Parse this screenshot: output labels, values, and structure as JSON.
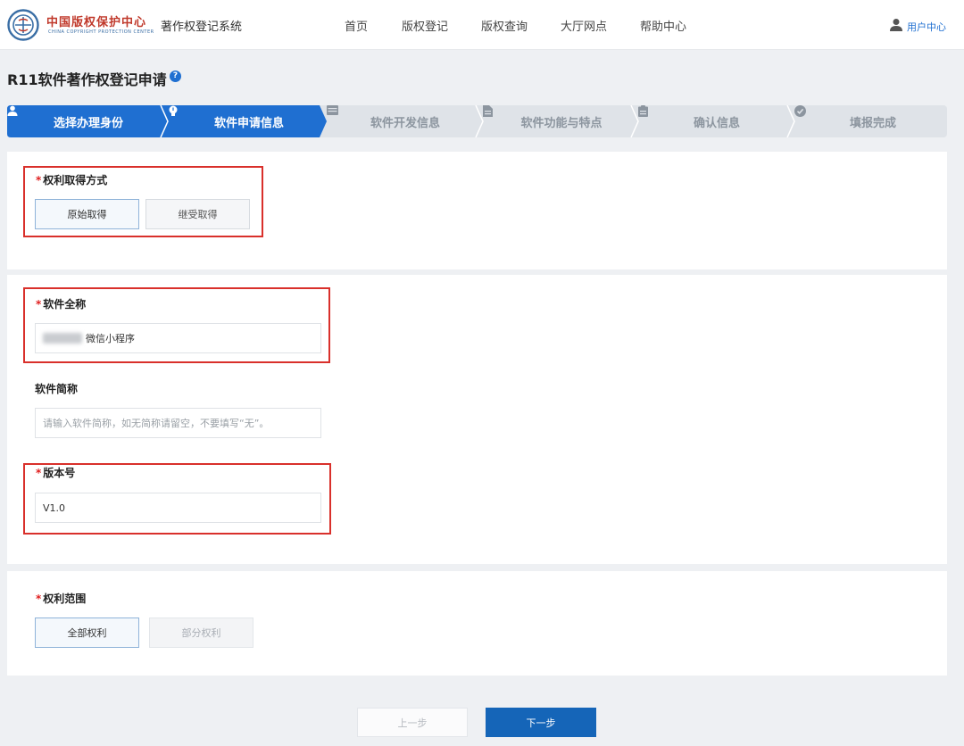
{
  "header": {
    "logo_cn": "中国版权保护中心",
    "logo_en": "CHINA COPYRIGHT PROTECTION CENTER",
    "system_title": "著作权登记系统",
    "nav": [
      "首页",
      "版权登记",
      "版权查询",
      "大厅网点",
      "帮助中心"
    ],
    "user_center": "用户中心"
  },
  "page": {
    "title": "R11软件著作权登记申请",
    "help_icon": "question-circle-icon"
  },
  "steps": [
    {
      "label": "选择办理身份",
      "icon": "user-icon",
      "state": "active"
    },
    {
      "label": "软件申请信息",
      "icon": "lightbulb-icon",
      "state": "active"
    },
    {
      "label": "软件开发信息",
      "icon": "window-icon",
      "state": "inactive"
    },
    {
      "label": "软件功能与特点",
      "icon": "document-icon",
      "state": "inactive"
    },
    {
      "label": "确认信息",
      "icon": "clipboard-icon",
      "state": "inactive"
    },
    {
      "label": "填报完成",
      "icon": "check-circle-icon",
      "state": "inactive"
    }
  ],
  "form": {
    "acquisition": {
      "required_mark": "*",
      "label": "权利取得方式",
      "options": [
        "原始取得",
        "继受取得"
      ],
      "selected": "原始取得"
    },
    "full_name": {
      "required_mark": "*",
      "label": "软件全称",
      "value": "微信小程序"
    },
    "short_name": {
      "label": "软件简称",
      "placeholder": "请输入软件简称，如无简称请留空，不要填写“无”。"
    },
    "version": {
      "required_mark": "*",
      "label": "版本号",
      "value": "V1.0"
    },
    "scope": {
      "required_mark": "*",
      "label": "权利范围",
      "options": [
        "全部权利",
        "部分权利"
      ],
      "selected": "全部权利"
    }
  },
  "footer": {
    "prev": "上一步",
    "next": "下一步"
  },
  "colors": {
    "primary": "#1565b8",
    "highlight_box": "#d9302b",
    "required": "#e02020"
  }
}
